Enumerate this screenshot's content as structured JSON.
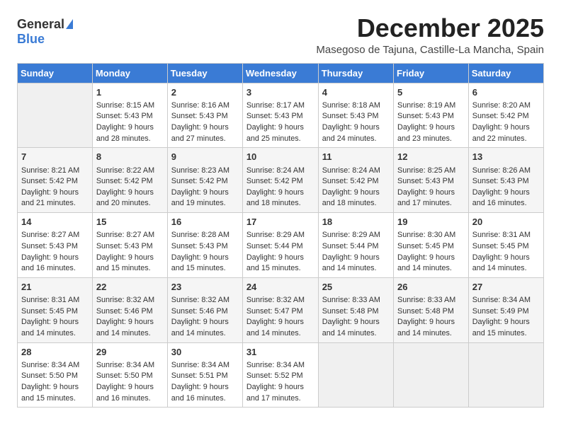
{
  "logo": {
    "general": "General",
    "blue": "Blue"
  },
  "title": "December 2025",
  "location": "Masegoso de Tajuna, Castille-La Mancha, Spain",
  "days_of_week": [
    "Sunday",
    "Monday",
    "Tuesday",
    "Wednesday",
    "Thursday",
    "Friday",
    "Saturday"
  ],
  "weeks": [
    [
      {
        "day": "",
        "sunrise": "",
        "sunset": "",
        "daylight": ""
      },
      {
        "day": "1",
        "sunrise": "Sunrise: 8:15 AM",
        "sunset": "Sunset: 5:43 PM",
        "daylight": "Daylight: 9 hours and 28 minutes."
      },
      {
        "day": "2",
        "sunrise": "Sunrise: 8:16 AM",
        "sunset": "Sunset: 5:43 PM",
        "daylight": "Daylight: 9 hours and 27 minutes."
      },
      {
        "day": "3",
        "sunrise": "Sunrise: 8:17 AM",
        "sunset": "Sunset: 5:43 PM",
        "daylight": "Daylight: 9 hours and 25 minutes."
      },
      {
        "day": "4",
        "sunrise": "Sunrise: 8:18 AM",
        "sunset": "Sunset: 5:43 PM",
        "daylight": "Daylight: 9 hours and 24 minutes."
      },
      {
        "day": "5",
        "sunrise": "Sunrise: 8:19 AM",
        "sunset": "Sunset: 5:43 PM",
        "daylight": "Daylight: 9 hours and 23 minutes."
      },
      {
        "day": "6",
        "sunrise": "Sunrise: 8:20 AM",
        "sunset": "Sunset: 5:42 PM",
        "daylight": "Daylight: 9 hours and 22 minutes."
      }
    ],
    [
      {
        "day": "7",
        "sunrise": "Sunrise: 8:21 AM",
        "sunset": "Sunset: 5:42 PM",
        "daylight": "Daylight: 9 hours and 21 minutes."
      },
      {
        "day": "8",
        "sunrise": "Sunrise: 8:22 AM",
        "sunset": "Sunset: 5:42 PM",
        "daylight": "Daylight: 9 hours and 20 minutes."
      },
      {
        "day": "9",
        "sunrise": "Sunrise: 8:23 AM",
        "sunset": "Sunset: 5:42 PM",
        "daylight": "Daylight: 9 hours and 19 minutes."
      },
      {
        "day": "10",
        "sunrise": "Sunrise: 8:24 AM",
        "sunset": "Sunset: 5:42 PM",
        "daylight": "Daylight: 9 hours and 18 minutes."
      },
      {
        "day": "11",
        "sunrise": "Sunrise: 8:24 AM",
        "sunset": "Sunset: 5:42 PM",
        "daylight": "Daylight: 9 hours and 18 minutes."
      },
      {
        "day": "12",
        "sunrise": "Sunrise: 8:25 AM",
        "sunset": "Sunset: 5:43 PM",
        "daylight": "Daylight: 9 hours and 17 minutes."
      },
      {
        "day": "13",
        "sunrise": "Sunrise: 8:26 AM",
        "sunset": "Sunset: 5:43 PM",
        "daylight": "Daylight: 9 hours and 16 minutes."
      }
    ],
    [
      {
        "day": "14",
        "sunrise": "Sunrise: 8:27 AM",
        "sunset": "Sunset: 5:43 PM",
        "daylight": "Daylight: 9 hours and 16 minutes."
      },
      {
        "day": "15",
        "sunrise": "Sunrise: 8:27 AM",
        "sunset": "Sunset: 5:43 PM",
        "daylight": "Daylight: 9 hours and 15 minutes."
      },
      {
        "day": "16",
        "sunrise": "Sunrise: 8:28 AM",
        "sunset": "Sunset: 5:43 PM",
        "daylight": "Daylight: 9 hours and 15 minutes."
      },
      {
        "day": "17",
        "sunrise": "Sunrise: 8:29 AM",
        "sunset": "Sunset: 5:44 PM",
        "daylight": "Daylight: 9 hours and 15 minutes."
      },
      {
        "day": "18",
        "sunrise": "Sunrise: 8:29 AM",
        "sunset": "Sunset: 5:44 PM",
        "daylight": "Daylight: 9 hours and 14 minutes."
      },
      {
        "day": "19",
        "sunrise": "Sunrise: 8:30 AM",
        "sunset": "Sunset: 5:45 PM",
        "daylight": "Daylight: 9 hours and 14 minutes."
      },
      {
        "day": "20",
        "sunrise": "Sunrise: 8:31 AM",
        "sunset": "Sunset: 5:45 PM",
        "daylight": "Daylight: 9 hours and 14 minutes."
      }
    ],
    [
      {
        "day": "21",
        "sunrise": "Sunrise: 8:31 AM",
        "sunset": "Sunset: 5:45 PM",
        "daylight": "Daylight: 9 hours and 14 minutes."
      },
      {
        "day": "22",
        "sunrise": "Sunrise: 8:32 AM",
        "sunset": "Sunset: 5:46 PM",
        "daylight": "Daylight: 9 hours and 14 minutes."
      },
      {
        "day": "23",
        "sunrise": "Sunrise: 8:32 AM",
        "sunset": "Sunset: 5:46 PM",
        "daylight": "Daylight: 9 hours and 14 minutes."
      },
      {
        "day": "24",
        "sunrise": "Sunrise: 8:32 AM",
        "sunset": "Sunset: 5:47 PM",
        "daylight": "Daylight: 9 hours and 14 minutes."
      },
      {
        "day": "25",
        "sunrise": "Sunrise: 8:33 AM",
        "sunset": "Sunset: 5:48 PM",
        "daylight": "Daylight: 9 hours and 14 minutes."
      },
      {
        "day": "26",
        "sunrise": "Sunrise: 8:33 AM",
        "sunset": "Sunset: 5:48 PM",
        "daylight": "Daylight: 9 hours and 14 minutes."
      },
      {
        "day": "27",
        "sunrise": "Sunrise: 8:34 AM",
        "sunset": "Sunset: 5:49 PM",
        "daylight": "Daylight: 9 hours and 15 minutes."
      }
    ],
    [
      {
        "day": "28",
        "sunrise": "Sunrise: 8:34 AM",
        "sunset": "Sunset: 5:50 PM",
        "daylight": "Daylight: 9 hours and 15 minutes."
      },
      {
        "day": "29",
        "sunrise": "Sunrise: 8:34 AM",
        "sunset": "Sunset: 5:50 PM",
        "daylight": "Daylight: 9 hours and 16 minutes."
      },
      {
        "day": "30",
        "sunrise": "Sunrise: 8:34 AM",
        "sunset": "Sunset: 5:51 PM",
        "daylight": "Daylight: 9 hours and 16 minutes."
      },
      {
        "day": "31",
        "sunrise": "Sunrise: 8:34 AM",
        "sunset": "Sunset: 5:52 PM",
        "daylight": "Daylight: 9 hours and 17 minutes."
      },
      {
        "day": "",
        "sunrise": "",
        "sunset": "",
        "daylight": ""
      },
      {
        "day": "",
        "sunrise": "",
        "sunset": "",
        "daylight": ""
      },
      {
        "day": "",
        "sunrise": "",
        "sunset": "",
        "daylight": ""
      }
    ]
  ]
}
